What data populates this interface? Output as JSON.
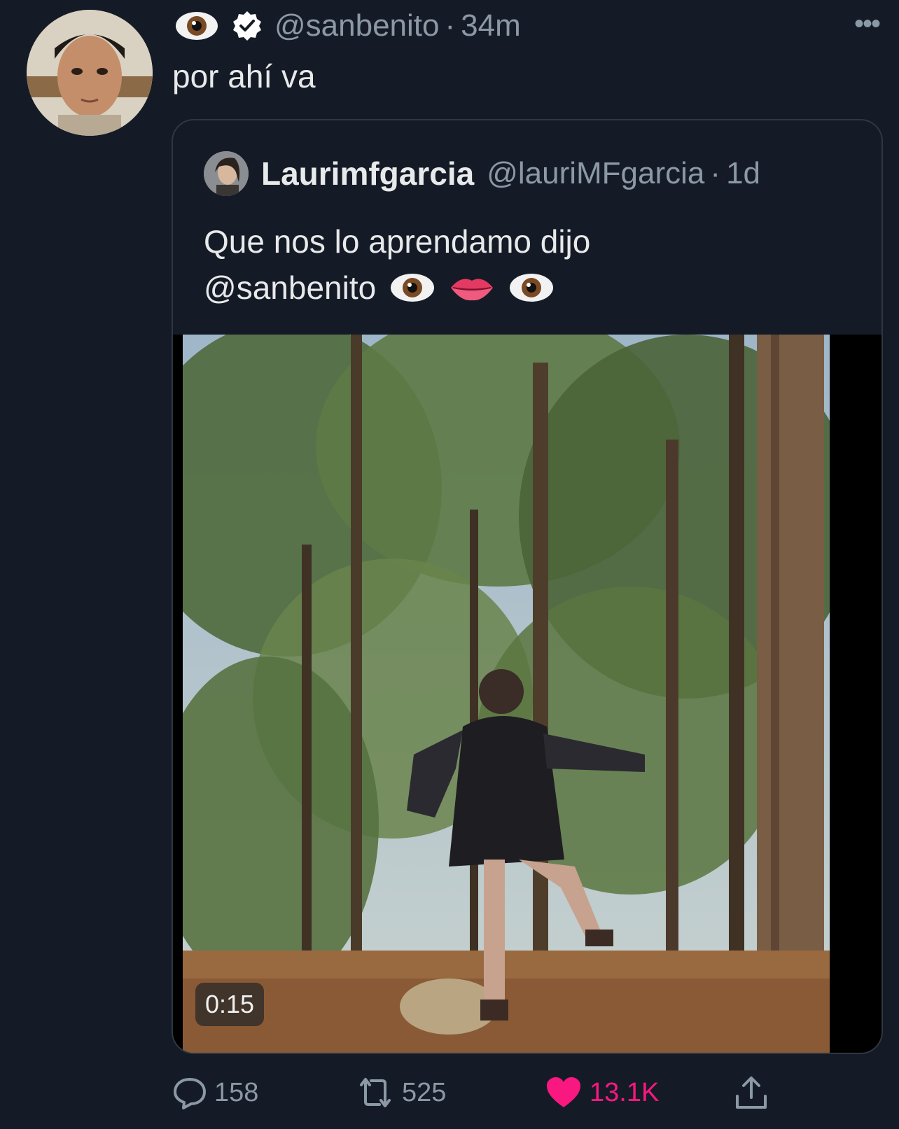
{
  "tweet": {
    "handle": "@sanbenito",
    "separator": "·",
    "time": "34m",
    "text": "por ahí va",
    "more_label": "•••"
  },
  "quoted": {
    "name": "Laurimfgarcia",
    "handle": "@lauriMFgarcia",
    "separator": "·",
    "time": "1d",
    "text_line1": "Que nos lo aprendamo dijo",
    "text_line2": "@sanbenito",
    "media": {
      "duration": "0:15"
    }
  },
  "actions": {
    "replies": "158",
    "retweets": "525",
    "likes": "13.1K"
  },
  "colors": {
    "background": "#151b26",
    "text": "#e7e9ea",
    "muted": "#8b98a5",
    "like": "#f91880",
    "border": "#2f3740"
  },
  "icons": [
    "eye-emoji",
    "verified-badge",
    "more-icon",
    "lips-emoji",
    "reply-icon",
    "retweet-icon",
    "heart-icon",
    "share-icon"
  ]
}
